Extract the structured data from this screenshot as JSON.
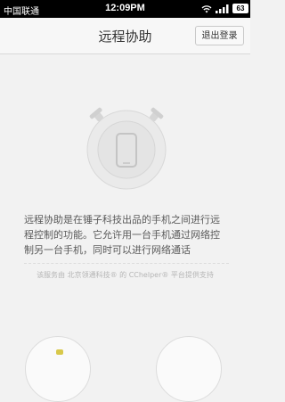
{
  "status_bar": {
    "carrier": "中国联通",
    "time": "12:09PM",
    "battery": "63"
  },
  "header": {
    "title": "远程协助",
    "logout_label": "退出登录"
  },
  "main": {
    "description": "远程协助是在锤子科技出品的手机之间进行远程控制的功能。它允许用一台手机通过网络控制另一台手机，同时可以进行网络通话",
    "credit": "该服务由 北京领通科技® 的 CChelper® 平台提供支持"
  },
  "icons": {
    "illustration": "phone-stopwatch-icon",
    "wifi": "wifi-icon",
    "signal": "signal-icon"
  },
  "colors": {
    "background": "#f2f2f2",
    "header": "#f7f7f7",
    "text": "#5a5a5a"
  }
}
